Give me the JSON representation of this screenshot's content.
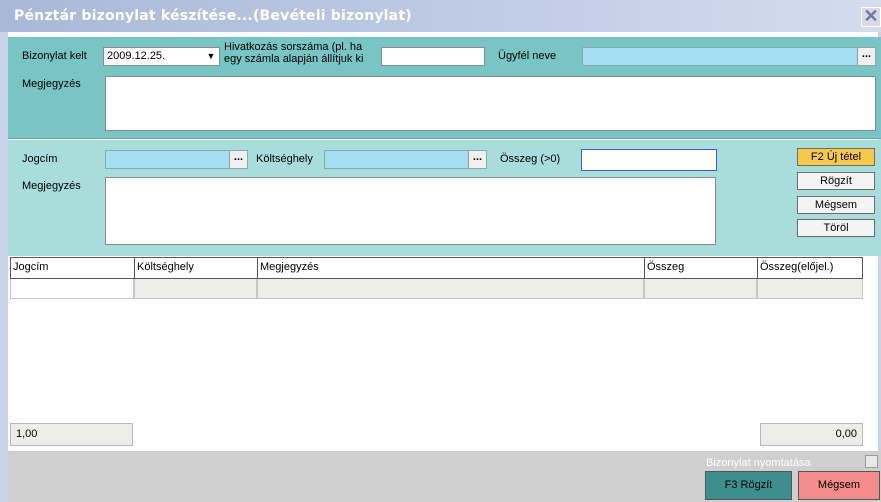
{
  "window": {
    "title": "Pénztár bizonylat készítése...(Bevételi bizonylat)"
  },
  "header": {
    "date_label": "Bizonylat kelt",
    "date_value": "2009.12.25.",
    "ref_label_line1": "Hivatkozás sorszáma (pl. ha",
    "ref_label_line2": "egy számla alapján állítjuk ki",
    "ref_value": "",
    "client_label": "Ügyfél neve",
    "client_value": "",
    "note_label": "Megjegyzés",
    "note_value": ""
  },
  "item": {
    "title_label": "Jogcím",
    "title_value": "",
    "cost_label": "Költséghely",
    "cost_value": "",
    "amount_label": "Összeg (>0)",
    "amount_value": "",
    "note_label": "Megjegyzés",
    "note_value": "",
    "buttons": {
      "new": "F2 Új tétel",
      "save": "Rögzít",
      "cancel": "Mégsem",
      "delete": "Töröl"
    }
  },
  "grid": {
    "columns": [
      "Jogcím",
      "Költséghely",
      "Megjegyzés",
      "Összeg",
      "Összeg(előjel.)"
    ]
  },
  "footer": {
    "count": "1,00",
    "total": "0,00"
  },
  "bottom": {
    "print_label": "Bizonylat nyomtatása",
    "save_button": "F3 Rögzít",
    "cancel_button": "Mégsem"
  },
  "icons": {
    "close": "close-icon",
    "dropdown": "chevron-down-icon",
    "ellipsis": "ellipsis-icon"
  },
  "colors": {
    "accent_top": "#79c4c4",
    "accent_mid": "#a9dddc",
    "lookup": "#a4dff1",
    "save": "#3d8f8d",
    "cancel": "#f58c8c",
    "active_button": "#f7c94a"
  }
}
